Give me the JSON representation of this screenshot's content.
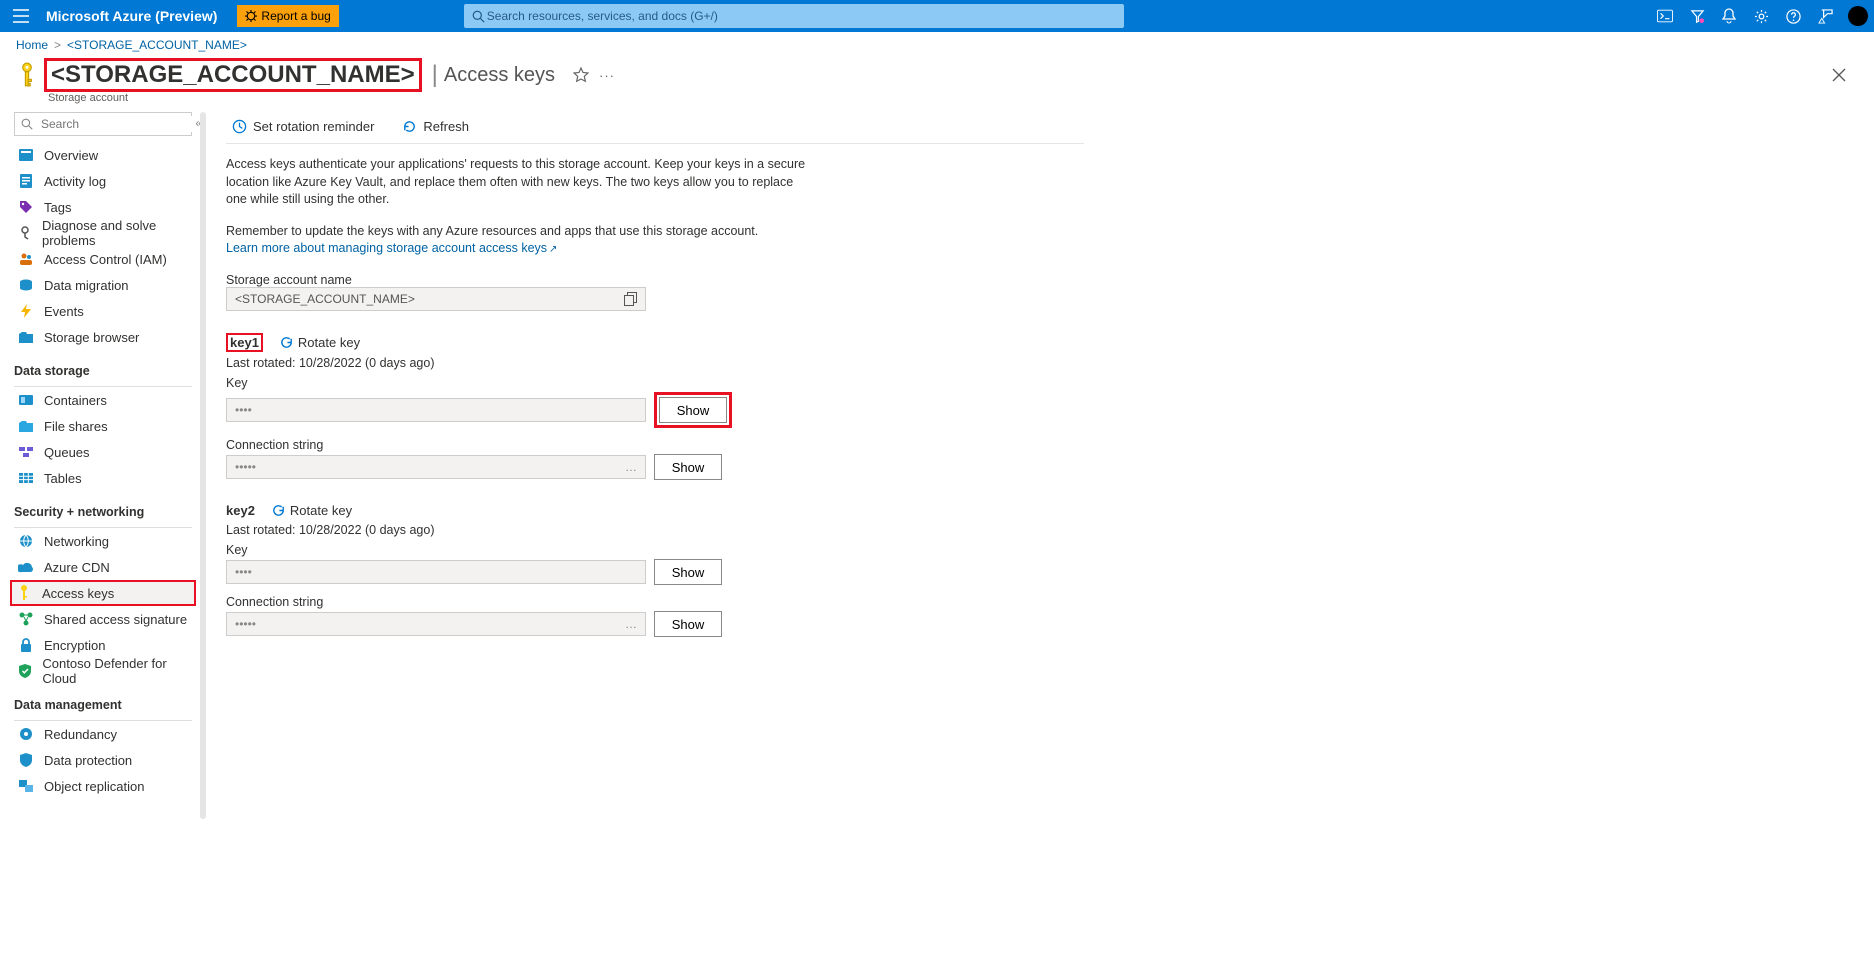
{
  "topbar": {
    "brand": "Microsoft Azure (Preview)",
    "report_bug": "Report a bug",
    "search_placeholder": "Search resources, services, and docs (G+/)"
  },
  "breadcrumb": {
    "home": "Home",
    "current": "<STORAGE_ACCOUNT_NAME>"
  },
  "title": {
    "account": "<STORAGE_ACCOUNT_NAME>",
    "section": "Access keys",
    "subtype": "Storage account"
  },
  "sidebar": {
    "search_placeholder": "Search",
    "first": [
      {
        "label": "Overview"
      },
      {
        "label": "Activity log"
      },
      {
        "label": "Tags"
      },
      {
        "label": "Diagnose and solve problems"
      },
      {
        "label": "Access Control (IAM)"
      },
      {
        "label": "Data migration"
      },
      {
        "label": "Events"
      },
      {
        "label": "Storage browser"
      }
    ],
    "section2_title": "Data storage",
    "section2": [
      {
        "label": "Containers"
      },
      {
        "label": "File shares"
      },
      {
        "label": "Queues"
      },
      {
        "label": "Tables"
      }
    ],
    "section3_title": "Security + networking",
    "section3": [
      {
        "label": "Networking"
      },
      {
        "label": "Azure CDN"
      },
      {
        "label": "Access keys"
      },
      {
        "label": "Shared access signature"
      },
      {
        "label": "Encryption"
      },
      {
        "label": "Contoso Defender for Cloud"
      }
    ],
    "section4_title": "Data management",
    "section4": [
      {
        "label": "Redundancy"
      },
      {
        "label": "Data protection"
      },
      {
        "label": "Object replication"
      }
    ]
  },
  "main": {
    "cmd_reminder": "Set rotation reminder",
    "cmd_refresh": "Refresh",
    "desc1": "Access keys authenticate your applications' requests to this storage account. Keep your keys in a secure location like Azure Key Vault, and replace them often with new keys. The two keys allow you to replace one while still using the other.",
    "desc2": "Remember to update the keys with any Azure resources and apps that use this storage account.",
    "learn_more": "Learn more about managing storage account access keys",
    "account_name_label": "Storage account name",
    "account_name_value": "<STORAGE_ACCOUNT_NAME>",
    "rotate_text": "Rotate key",
    "key_label": "Key",
    "connstr_label": "Connection string",
    "show_text": "Show",
    "mask_short": "••••",
    "mask_long": "•••••",
    "keys": [
      {
        "name": "key1",
        "last_rotated": "Last rotated: 10/28/2022 (0 days ago)"
      },
      {
        "name": "key2",
        "last_rotated": "Last rotated: 10/28/2022 (0 days ago)"
      }
    ]
  }
}
